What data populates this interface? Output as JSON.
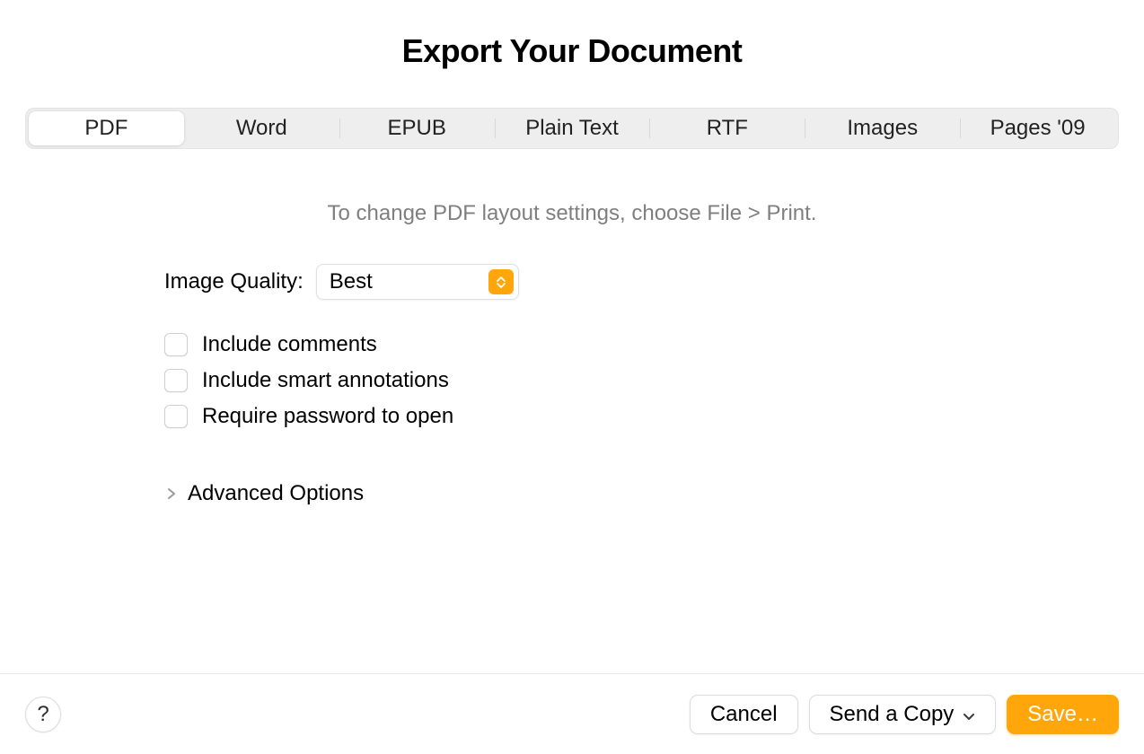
{
  "title": "Export Your Document",
  "tabs": [
    {
      "label": "PDF",
      "active": true
    },
    {
      "label": "Word",
      "active": false
    },
    {
      "label": "EPUB",
      "active": false
    },
    {
      "label": "Plain Text",
      "active": false
    },
    {
      "label": "RTF",
      "active": false
    },
    {
      "label": "Images",
      "active": false
    },
    {
      "label": "Pages '09",
      "active": false
    }
  ],
  "hint": "To change PDF layout settings, choose File > Print.",
  "imageQuality": {
    "label": "Image Quality:",
    "value": "Best"
  },
  "checks": {
    "includeComments": "Include comments",
    "includeSmartAnnotations": "Include smart annotations",
    "requirePassword": "Require password to open"
  },
  "advanced": "Advanced Options",
  "footer": {
    "help": "?",
    "cancel": "Cancel",
    "sendCopy": "Send a Copy",
    "save": "Save…"
  },
  "colors": {
    "accent": "#ffa60a"
  }
}
